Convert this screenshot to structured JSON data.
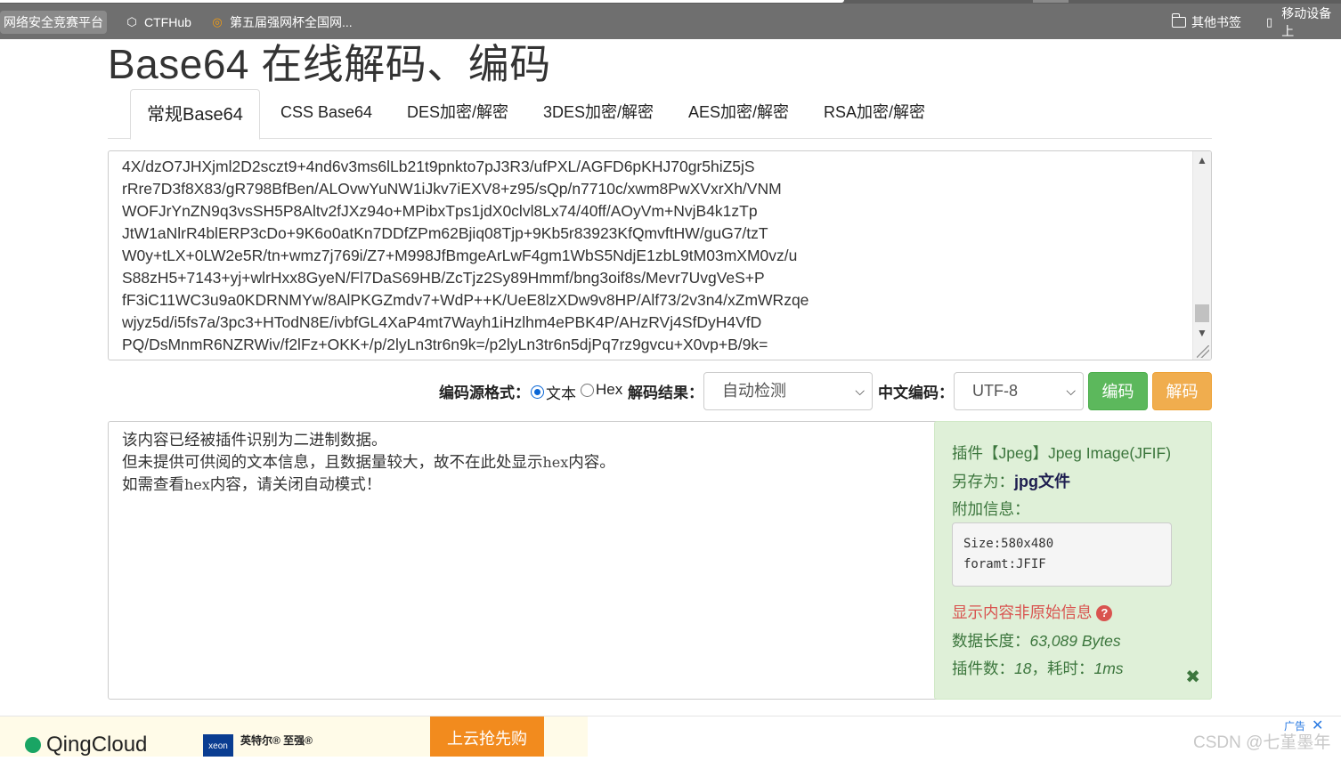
{
  "bookmarks_bar": {
    "items": [
      {
        "label": "网络安全竞赛平台"
      },
      {
        "label": "CTFHub"
      },
      {
        "label": "第五届强网杯全国网..."
      }
    ],
    "right_items": [
      {
        "label": "其他书签"
      },
      {
        "label": "移动设备上"
      }
    ]
  },
  "page": {
    "title": "Base64 在线解码、编码"
  },
  "tabs": [
    {
      "label": "常规Base64",
      "active": true
    },
    {
      "label": "CSS Base64"
    },
    {
      "label": "DES加密/解密"
    },
    {
      "label": "3DES加密/解密"
    },
    {
      "label": "AES加密/解密"
    },
    {
      "label": "RSA加密/解密"
    }
  ],
  "source": {
    "lines": [
      "4X/dzO7JHXjml2D2sczt9+4nd6v3ms6lLb21t9pnkto7pJ3R3/ufPXL/AGFD6pKHJ70gr5hiZ5jS",
      "rRre7D3f8X83/gR798BfBen/ALOvwYuNW1iJkv7iEXV8+z95/sQp/n7710c/xwm8PwXVxrXh/VNM",
      "WOFJrYnZN9q3vsSH5P8Altv2fJXz94o+MPibxTps1jdX0clvl8Lx74/40ff/AOyVm+NvjB4k1zTp",
      "JtW1aNlrR4blERP3cDo+9K6o0atKn7DDfZPm62Bjiq08Tjp+9Kb5r83923KfQmvftHW/guG7/tzT",
      "W0y+tLX+0LW2e5R/tn+wmz7j769i/Z7+M998JfBmgeArLwF4gm1WbS5NdjE1zbL9tM03mXM0vz/u",
      "S88zH5+7143+yj+wlrHxx8GyeN/Fl7DaS69HB/ZcTjz2Sy89Hmmf/bng3oif8s/Mevr7UvgVeS+P",
      "fF3iC11WC3u9a0KDRNMYw/8AlPKGZmdv7+WdP++K/UeE8lzXDw9v8HP/Alf73/2v3n4/xZmWRzqe",
      "wjyz5d/i5fs7a/3pc3+HTodN8E/ivbfGL4XaP4mt7Wayh1iHzlhm4ePBK4P/AHzRVj4SfDyH4VfD",
      "PQ/DsMnmR6NZRWiv/f2lFz+OKK+/p/2lyLn3tr6n9k=/p2lyLn3tr6n5djPq7rz9gvcu+X0vp+B/9k="
    ]
  },
  "controls": {
    "source_format_label": "编码源格式：",
    "radio_text": "文本",
    "radio_hex": "Hex",
    "result_label": "解码结果：",
    "result_select": "自动检测",
    "charset_label": "中文编码：",
    "charset_select": "UTF-8",
    "encode_button": "编码",
    "decode_button": "解码"
  },
  "result": {
    "line1": "该内容已经被插件识别为二进制数据。",
    "line2_pre": "但未提供可供阅的文本信息，且数据量较大，故不在此处显示",
    "line2_mono": "hex",
    "line2_post": "内容。",
    "line3_pre": "如需查看",
    "line3_mono": "hex",
    "line3_post": "内容，请关闭自动模式！"
  },
  "plugin": {
    "title": "插件【Jpeg】Jpeg Image(JFIF)",
    "save_as_label": "另存为：",
    "save_as_link": "jpg文件",
    "extra_label": "附加信息：",
    "extra_lines": [
      "Size:580x480",
      "foramt:JFIF"
    ],
    "show_raw": "显示内容非原始信息",
    "data_length_label": "数据长度：",
    "data_length_value": "63,089 Bytes",
    "plugins_label": "插件数：",
    "plugins_value": "18",
    "time_label": "，耗时：",
    "time_value": "1ms"
  },
  "ad": {
    "brand": "QingCloud",
    "intel_logo": "xeon",
    "intel_text": "英特尔® 至强®",
    "promo": "上云抢先购",
    "tag": "广告"
  },
  "watermark": "CSDN @七堇墨年"
}
